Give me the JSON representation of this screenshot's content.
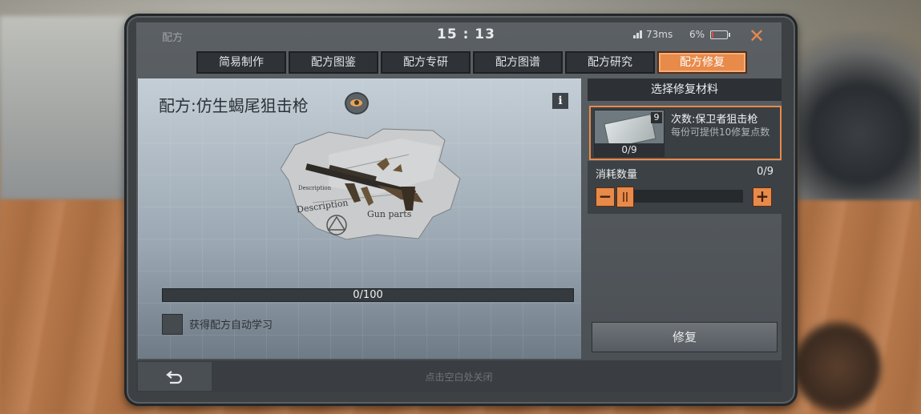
{
  "status": {
    "title": "配方",
    "clock": "15 : 13",
    "ping": "73ms",
    "battery": "6%"
  },
  "tabs": [
    {
      "label": "简易制作",
      "active": false
    },
    {
      "label": "配方图鉴",
      "active": false
    },
    {
      "label": "配方专研",
      "active": false
    },
    {
      "label": "配方图谱",
      "active": false
    },
    {
      "label": "配方研究",
      "active": false
    },
    {
      "label": "配方修复",
      "active": true
    }
  ],
  "recipe": {
    "title": "配方:仿生蝎尾狙击枪",
    "blueprint_labels": [
      "Description",
      "Gun parts",
      "Description"
    ],
    "progress_text": "0/100",
    "progress_value": 0,
    "auto_learn_label": "获得配方自动学习"
  },
  "repair_panel": {
    "header": "选择修复材料",
    "material": {
      "name": "次数:保卫者狙击枪",
      "description": "每份可提供10修复点数",
      "badge": "9",
      "count": "0/9"
    },
    "consume_label": "消耗数量",
    "consume_value": "0/9",
    "repair_button": "修复"
  },
  "bottom": {
    "hint": "点击空白处关闭"
  },
  "colors": {
    "accent": "#e88a4a",
    "panel_dark": "#2d3135"
  }
}
